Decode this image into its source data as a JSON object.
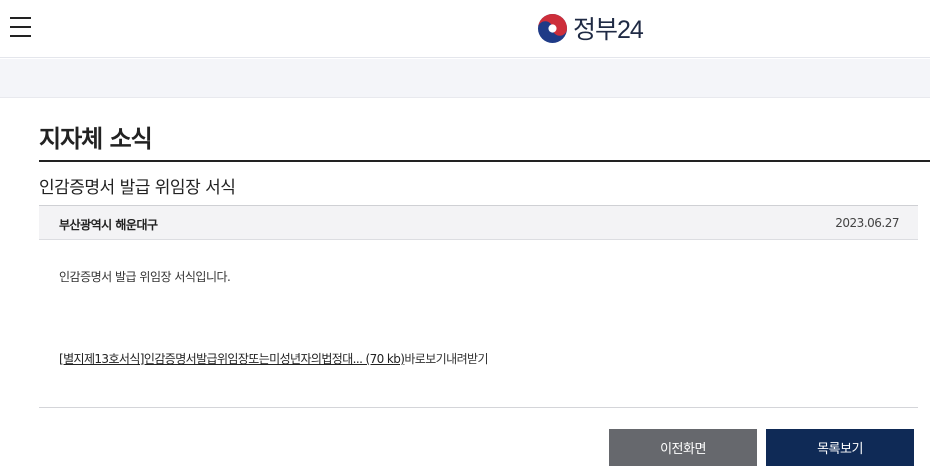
{
  "header": {
    "menu_icon": "hamburger-menu-icon",
    "logo_icon": "taegeuk-emblem-icon",
    "logo_text": "정부24"
  },
  "page": {
    "title": "지자체 소식"
  },
  "post": {
    "title": "인감증명서 발급 위임장 서식",
    "department": "부산광역시 해운대구",
    "date": "2023.06.27",
    "body": "인감증명서 발급 위임장 서식입니다.",
    "attachment": {
      "name": "[별지제13호서식]인감증명서발급위임장또는미성년자의법정대... (70 kb)",
      "view_label": "바로보기",
      "download_label": "내려받기"
    }
  },
  "buttons": {
    "prev": "이전화면",
    "list": "목록보기"
  },
  "colors": {
    "prev_button": "#66686d",
    "list_button": "#0f2a56",
    "logo_red": "#cd2e3a",
    "logo_blue": "#1f3b87"
  }
}
